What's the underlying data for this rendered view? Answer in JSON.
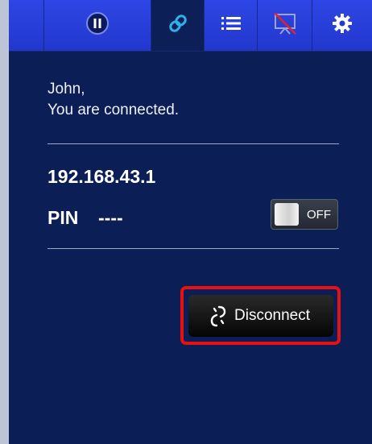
{
  "toolbar": {
    "buttons": [
      {
        "name": "pause",
        "icon": "pause-icon",
        "active": false
      },
      {
        "name": "connection",
        "icon": "link-icon",
        "active": true
      },
      {
        "name": "list",
        "icon": "list-icon",
        "active": false
      },
      {
        "name": "no-presentation",
        "icon": "presentation-off-icon",
        "active": false
      },
      {
        "name": "settings",
        "icon": "gear-icon",
        "active": false
      }
    ]
  },
  "status": {
    "user_name": "John,",
    "message": "You are connected."
  },
  "connection": {
    "ip_address": "192.168.43.1",
    "pin_label": "PIN",
    "pin_value": "----",
    "pin_toggle_state": "OFF"
  },
  "actions": {
    "disconnect_label": "Disconnect",
    "disconnect_icon": "broken-link-icon"
  },
  "colors": {
    "panel_background": "#0b1e55",
    "toolbar": "#2237cc",
    "highlight": "#e81010"
  }
}
